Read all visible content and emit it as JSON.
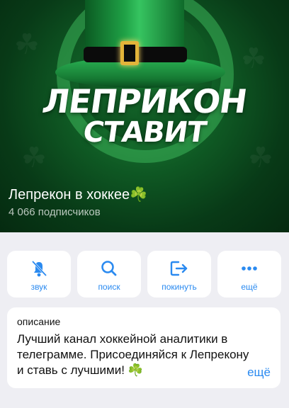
{
  "header": {
    "brand_line1": "ЛЕПРИКОН",
    "brand_line2": "СТАВИТ",
    "channel_name": "Лепрекон в хоккее",
    "channel_emoji": "☘️",
    "subscribers": "4 066 подписчиков"
  },
  "actions": [
    {
      "label": "звук",
      "icon": "bell-muted-icon"
    },
    {
      "label": "поиск",
      "icon": "search-icon"
    },
    {
      "label": "покинуть",
      "icon": "leave-icon"
    },
    {
      "label": "ещё",
      "icon": "more-dots-icon"
    }
  ],
  "description": {
    "title": "описание",
    "text": "Лучший канал хоккейной аналитики в телеграмме. Присоединяйся к Лепрекону и ставь с лучшими! ☘️",
    "more": "ещё"
  },
  "colors": {
    "accent": "#2a8af0",
    "header_bg": "#0f5a24"
  }
}
